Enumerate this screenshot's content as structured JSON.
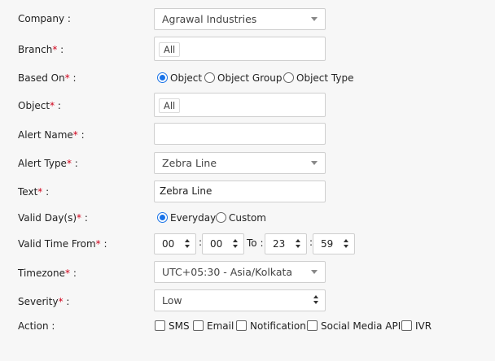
{
  "form": {
    "company": {
      "label": "Company :",
      "value": "Agrawal Industries"
    },
    "branch": {
      "label": "Branch",
      "suffix": " :",
      "tag": "All"
    },
    "based_on": {
      "label": "Based On",
      "suffix": " :",
      "options": [
        {
          "label": "Object",
          "selected": true
        },
        {
          "label": "Object Group",
          "selected": false
        },
        {
          "label": "Object Type",
          "selected": false
        }
      ]
    },
    "object": {
      "label": "Object",
      "suffix": " :",
      "tag": "All"
    },
    "alert_name": {
      "label": "Alert Name",
      "suffix": " :",
      "value": ""
    },
    "alert_type": {
      "label": "Alert Type",
      "suffix": " :",
      "value": "Zebra Line"
    },
    "text": {
      "label": "Text",
      "suffix": " :",
      "value": "Zebra Line"
    },
    "valid_days": {
      "label": "Valid Day(s)",
      "suffix": " :",
      "options": [
        {
          "label": "Everyday",
          "selected": true
        },
        {
          "label": "Custom",
          "selected": false
        }
      ]
    },
    "valid_time": {
      "label": "Valid Time From",
      "suffix": " :",
      "from_hour": "00",
      "from_minute": "00",
      "to_label": "To :",
      "to_hour": "23",
      "to_minute": "59",
      "colon": ":"
    },
    "timezone": {
      "label": "Timezone",
      "suffix": " :",
      "value": "UTC+05:30 - Asia/Kolkata"
    },
    "severity": {
      "label": "Severity",
      "suffix": " :",
      "value": "Low"
    },
    "action": {
      "label": "Action :",
      "options": [
        "SMS",
        "Email",
        "Notification",
        "Social Media API",
        "IVR"
      ]
    },
    "required_mark": "*"
  },
  "colors": {
    "required": "#d0021b",
    "accent": "#1a73e8"
  }
}
